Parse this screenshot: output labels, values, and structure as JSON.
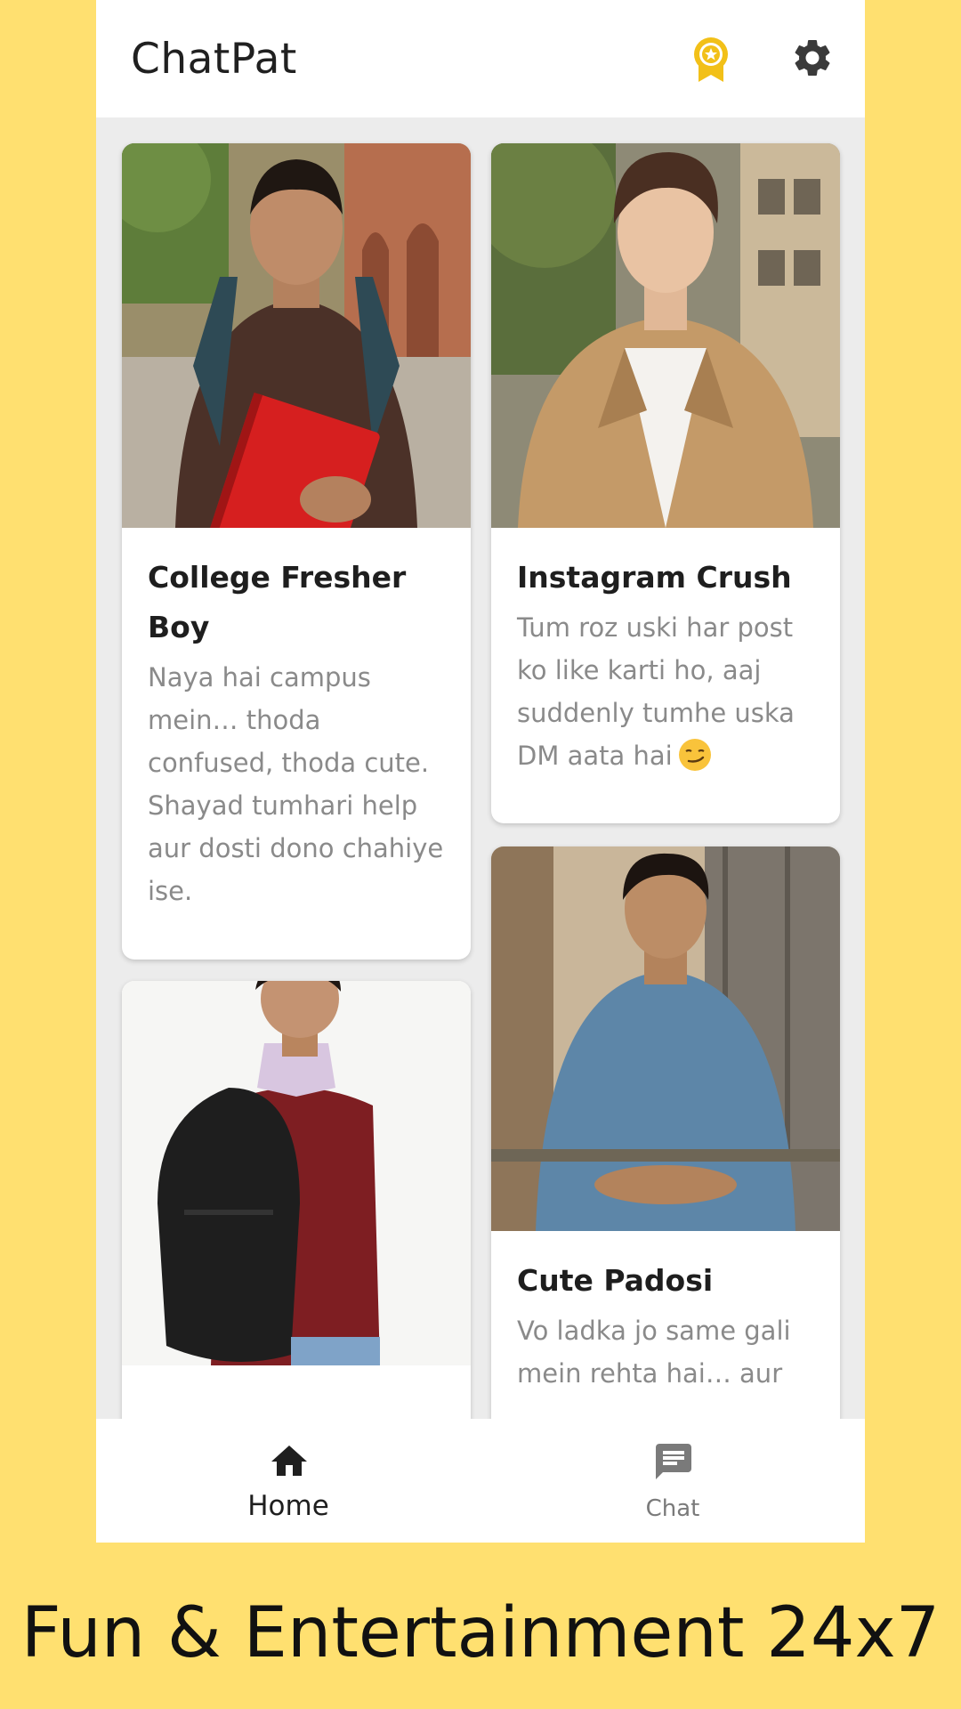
{
  "app": {
    "title": "ChatPat"
  },
  "header": {
    "icons": [
      "award-icon",
      "gear-icon"
    ]
  },
  "cards": [
    {
      "title": "College Fresher Boy",
      "description": "Naya hai campus mein… thoda confused, thoda cute. Shayad tumhari help aur dosti dono chahiye ise."
    },
    {
      "title": "Instagram Crush",
      "description": "Tum roz uski har post ko like karti ho, aaj suddenly tumhe uska DM aata hai",
      "emoji": "smirk-emoji"
    },
    {
      "title": "Cute Padosi",
      "description": "Vo ladka jo same gali mein rehta hai… aur"
    },
    {
      "title": "",
      "description": ""
    }
  ],
  "bottom_nav": {
    "items": [
      {
        "label": "Home",
        "icon": "home-icon",
        "active": true
      },
      {
        "label": "Chat",
        "icon": "chat-icon",
        "active": false
      }
    ]
  },
  "promo": {
    "text": "Fun & Entertainment 24x7"
  },
  "colors": {
    "background": "#FFE070",
    "accent_award": "#F2C018",
    "surface": "#FFFFFF",
    "feed_bg": "#ECECEC"
  }
}
